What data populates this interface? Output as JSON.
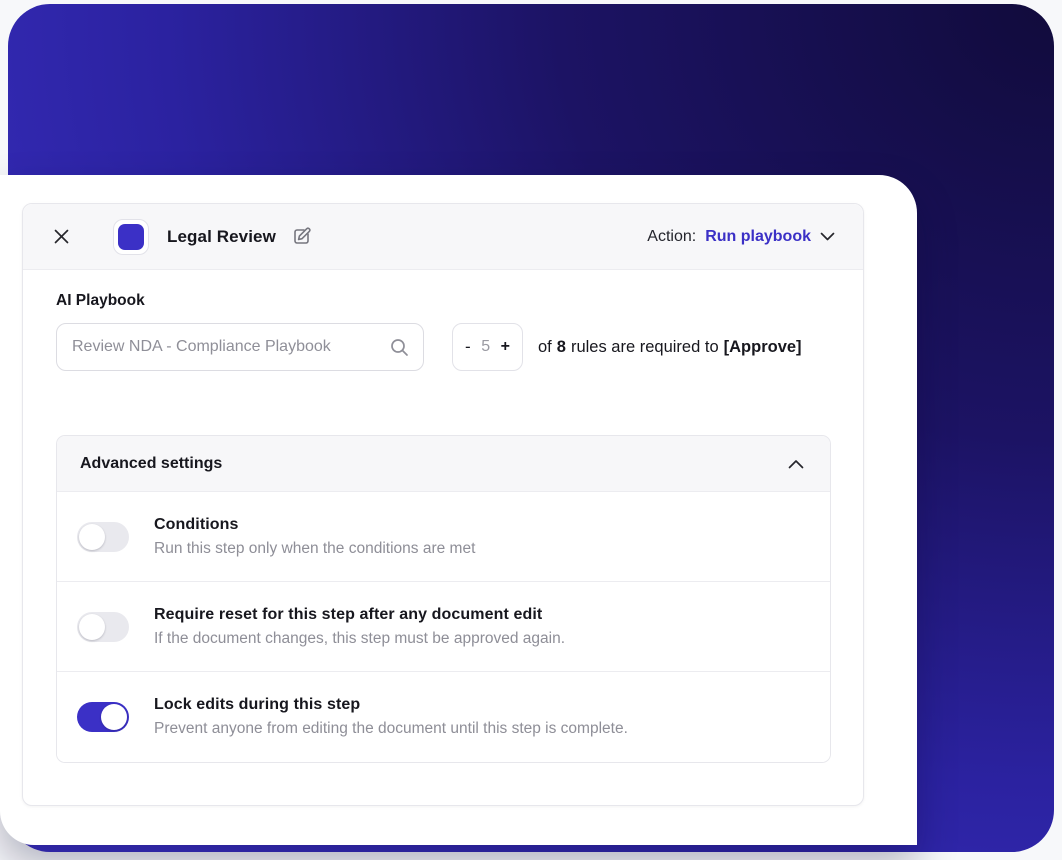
{
  "modal": {
    "title": "Legal Review",
    "action_label": "Action:",
    "action_value": "Run playbook"
  },
  "playbook": {
    "label": "AI Playbook",
    "input_value": "Review NDA - Compliance Playbook",
    "stepper": {
      "minus": "-",
      "value": "5",
      "plus": "+"
    },
    "rules": {
      "of": "of",
      "count": "8",
      "text": "rules are required to",
      "target": "[Approve]"
    }
  },
  "advanced": {
    "title": "Advanced settings",
    "rows": [
      {
        "title": "Conditions",
        "description": "Run this step only when the conditions are met",
        "enabled": false
      },
      {
        "title": "Require reset for this step after any document edit",
        "description": "If the document changes, this step must be approved again.",
        "enabled": false
      },
      {
        "title": "Lock edits during this step",
        "description": "Prevent anyone from editing the document until this step is complete.",
        "enabled": true
      }
    ]
  },
  "colors": {
    "accent": "#3b30c6",
    "background_dark": "#110b3c",
    "background_bright": "#3a30c4",
    "toggle_off": "#e9e9ee"
  }
}
